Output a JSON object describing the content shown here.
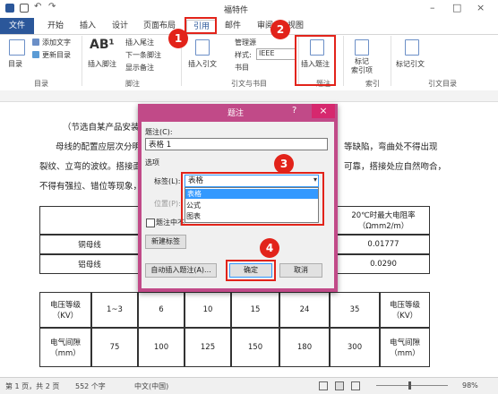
{
  "titlebar": {
    "title": "福特件"
  },
  "tabs": [
    {
      "label": "文件"
    },
    {
      "label": "开始"
    },
    {
      "label": "插入"
    },
    {
      "label": "设计"
    },
    {
      "label": "页面布局"
    },
    {
      "label": "引用"
    },
    {
      "label": "邮件"
    },
    {
      "label": "审阅"
    },
    {
      "label": "视图"
    }
  ],
  "ribbon": {
    "toc": "目录",
    "add_text": "添加文字",
    "update_toc": "更新目录",
    "insert_footnote": "插入脚注",
    "insert_endnote": "插入尾注",
    "next_footnote": "下一条脚注",
    "show_notes": "显示备注",
    "insert_citation": "插入引文",
    "manage_sources": "管理源",
    "style_label": "样式:",
    "style_value": "IEEE",
    "bibliography": "书目",
    "insert_caption": "插入题注",
    "mark_entry": "标记\n索引项",
    "mark_citation": "标记引文",
    "groups": {
      "toc": "目录",
      "footnotes": "脚注",
      "citations": "引文与书目",
      "captions": "题注",
      "index": "索引",
      "authorities": "引文目录"
    }
  },
  "document": {
    "line1": "（节选自某产品安装说",
    "line2a": "母线的配置应层次分明",
    "line2b": "等缺陷，弯曲处不得出现",
    "line3a": "裂纹、立弯的波纹。搭接面",
    "line3b": "可靠，搭接处应自然吻合，",
    "line4": "不得有强拉、错位等现象，",
    "table1": {
      "header_right": "20℃时最大电阻率（Ωmm2/m）",
      "row1_label": "铜母线",
      "row1_value": "0.01777",
      "row2_label": "铝母线",
      "row2_value": "0.0290"
    },
    "table2": {
      "row1": [
        "电压等级（KV）",
        "1~3",
        "6",
        "10",
        "15",
        "24",
        "35",
        "电压等级（KV）"
      ],
      "row2": [
        "电气间隙（mm）",
        "75",
        "100",
        "125",
        "150",
        "180",
        "300",
        "电气间隙（mm）"
      ]
    }
  },
  "dialog": {
    "title": "题注",
    "help": "?",
    "close": "×",
    "caption_label": "题注(C):",
    "caption_value": "表格 1",
    "options_label": "选项",
    "label_label": "标签(L):",
    "label_value": "表格",
    "dropdown_options": [
      "表格",
      "公式",
      "图表"
    ],
    "position_label": "位置(P):",
    "exclude_label": "题注中不",
    "new_label_button": "新建标签",
    "auto_caption_button": "自动插入题注(A)...",
    "ok_button": "确定",
    "cancel_button": "取消"
  },
  "badges": [
    "1",
    "2",
    "3",
    "4"
  ],
  "status": {
    "page": "第 1 页，共 2 页",
    "words": "552 个字",
    "lang": "中文(中国)",
    "zoom": "98%"
  },
  "colors": {
    "accent": "#2b579a",
    "dialog": "#c14a88",
    "highlight": "#e2231a",
    "selection": "#3399ff"
  }
}
